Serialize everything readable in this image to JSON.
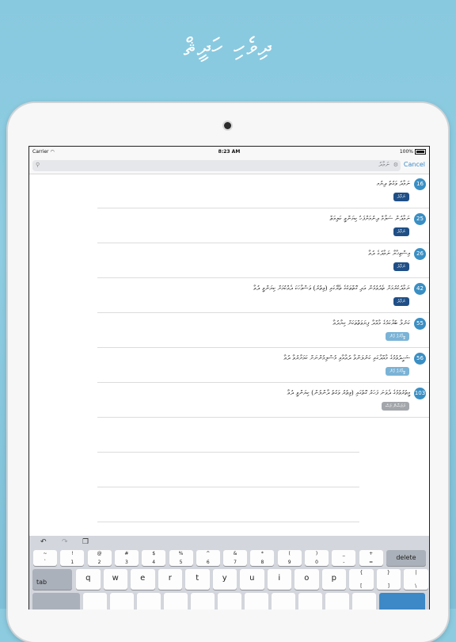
{
  "promo": {
    "title": "ދިވެހި ހަދީޘް"
  },
  "status": {
    "carrier": "Carrier",
    "time": "8:23 AM",
    "battery": "100%"
  },
  "search": {
    "value": "ނަމާދު",
    "cancel": "Cancel"
  },
  "colors": {
    "badge": "#3a8fc4",
    "tag_dark": "#1f4f86",
    "tag_light": "#7ab3d6",
    "tag_gray": "#a3a7ab"
  },
  "results": [
    {
      "number": "16",
      "text": "ނަމާދު ވަގުތު ދިޔުމ",
      "tag": "ނަމާދު",
      "tag_color": "#1f4f86"
    },
    {
      "number": "25",
      "text": "ނަމާދުން ސަލާމް ދިނުމަށްފަހު ކިޔަންވީ ކަލިމަތް",
      "tag": "ނަމާދު",
      "tag_color": "#1f4f86"
    },
    {
      "number": "26",
      "text": "އިސްތިޚާރާ ނަމާދުގެ ދުޢާ",
      "tag": "ނަމާދު",
      "tag_color": "#1f4f86"
    },
    {
      "number": "42",
      "text": "ނަމާދުކުރުމަށް ތެދުވުމުން އަދި ގޮތްތަކުގެ ތެރޭގައި (ވިތުރު) ވަސްވާހަކަ ދެއްކުމަށް ކިޔަންވީ ދުޢާ",
      "tag": "ނަމާދު",
      "tag_color": "#1f4f86"
    },
    {
      "number": "55",
      "text": "ކަނުލާ ބުރާކަމުގެ މާއްދާ ފިޔަވަތްތަކަށް ކިޔާދުޢާ",
      "tag": "ބީމާރުގެ ގެން",
      "tag_color": "#7ab3d6"
    },
    {
      "number": "56",
      "text": "ޝަހީދުވުމުގެ މާއްދާގައި ކަނުލަންވާ ދުޢާއާއި މުސްލިމުންނަށް ކަމަށާރުވާ ދުޢާ",
      "tag": "ބީމާރުގެ ގެން",
      "tag_color": "#7ab3d6"
    },
    {
      "number": "103",
      "text": "މީތުރުވުމުގެ ދެވަނަ ފަހަރު ގޮތުގައި (ވިތުރު ވަގުތު ދާންލުން) ކިޔަންވީ ދުޢާ",
      "tag": "ރަމަޟާން މަސް",
      "tag_color": "#a3a7ab"
    }
  ],
  "keyboard": {
    "tools": [
      "undo-icon",
      "redo-icon",
      "paste-icon"
    ],
    "row1": [
      [
        "~",
        "`"
      ],
      [
        "!",
        "1"
      ],
      [
        "@",
        "2"
      ],
      [
        "#",
        "3"
      ],
      [
        "$",
        "4"
      ],
      [
        "%",
        "5"
      ],
      [
        "^",
        "6"
      ],
      [
        "&",
        "7"
      ],
      [
        "*",
        "8"
      ],
      [
        "(",
        "9"
      ],
      [
        ")",
        "0"
      ],
      [
        "_",
        "-"
      ],
      [
        "+",
        "="
      ]
    ],
    "delete": "delete",
    "tab": "tab",
    "row2": [
      "q",
      "w",
      "e",
      "r",
      "t",
      "y",
      "u",
      "i",
      "o",
      "p"
    ],
    "row2_extra": [
      [
        "{",
        "["
      ],
      [
        "}",
        "]"
      ],
      [
        "|",
        "\\"
      ]
    ]
  }
}
